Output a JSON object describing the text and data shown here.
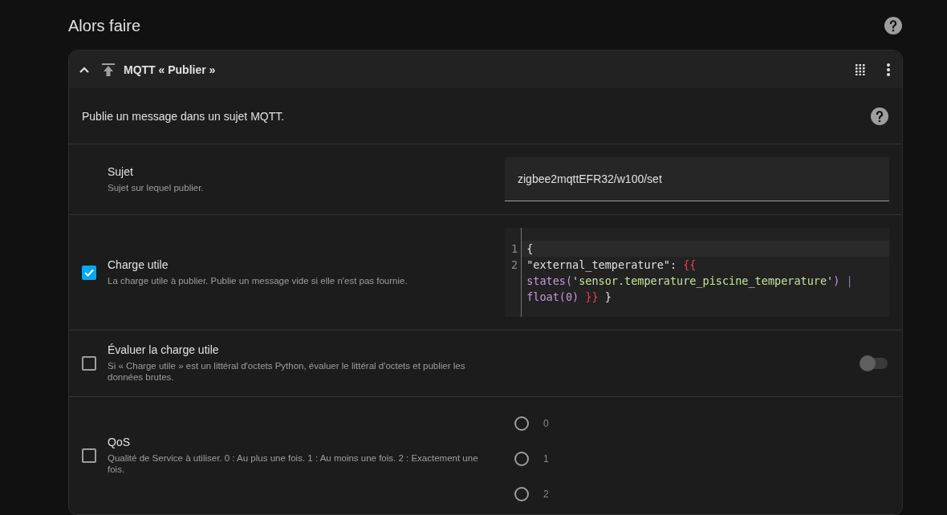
{
  "section_title": "Alors faire",
  "card": {
    "expanded": true,
    "title": "MQTT « Publier »",
    "description": "Publie un message dans un sujet MQTT.",
    "fields": [
      {
        "kind": "text",
        "label": "Sujet",
        "hint": "Sujet sur lequel publier.",
        "value": "zigbee2mqttEFR32/w100/set"
      },
      {
        "kind": "code",
        "checkbox": {
          "checked": true
        },
        "label": "Charge utile",
        "hint": "La charge utile à publier. Publie un message vide si elle n'est pas fournie.",
        "code_lines": [
          [
            {
              "kind": "plain",
              "text": "{"
            }
          ],
          [
            {
              "kind": "plain",
              "text": "\"external_temperature\": "
            },
            {
              "kind": "brace",
              "text": "{{"
            },
            {
              "kind": "func",
              "text": " states("
            },
            {
              "kind": "string",
              "text": "'sensor.temperature_piscine_temperature'"
            },
            {
              "kind": "func",
              "text": ")"
            },
            {
              "kind": "pipe",
              "text": " |"
            },
            {
              "kind": "func",
              "text": " float(0)"
            },
            {
              "kind": "brace",
              "text": " }}"
            },
            {
              "kind": "plain",
              "text": " }"
            }
          ]
        ],
        "line_numbers": [
          "1",
          "2"
        ]
      },
      {
        "kind": "toggle",
        "checkbox": {
          "checked": false
        },
        "label": "Évaluer la charge utile",
        "hint": "Si « Charge utile » est un littéral d'octets Python, évaluer le littéral d'octets et publier les données brutes.",
        "on": false
      },
      {
        "kind": "radio",
        "checkbox": {
          "checked": false
        },
        "label": "QoS",
        "hint": "Qualité de Service à utiliser. 0 : Au plus une fois. 1 : Au moins une fois. 2 : Exactement une fois.",
        "options": [
          {
            "label": "0",
            "selected": false
          },
          {
            "label": "1",
            "selected": false
          },
          {
            "label": "2",
            "selected": false
          }
        ]
      }
    ]
  }
}
